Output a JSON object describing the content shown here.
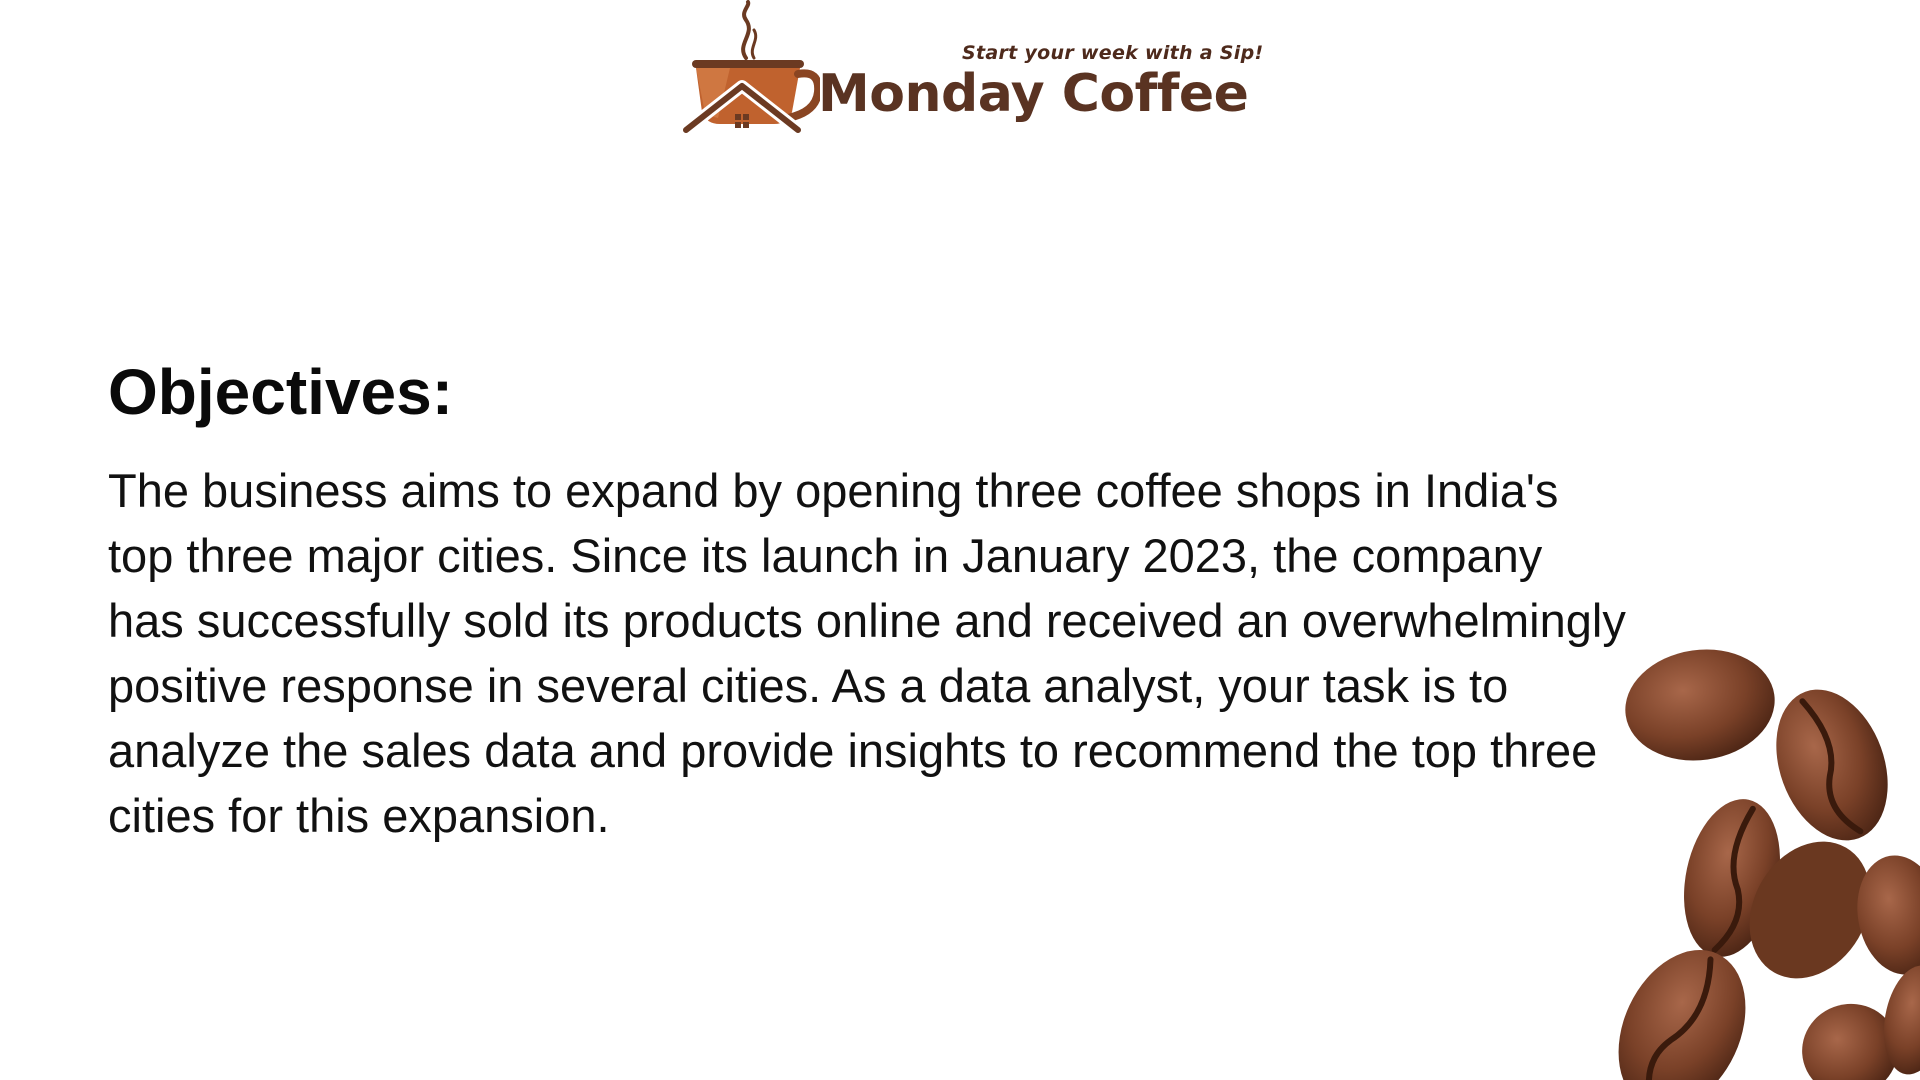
{
  "logo": {
    "tagline": "Start your week with a Sip!",
    "brand_name": "Monday Coffee"
  },
  "colors": {
    "brand_brown": "#5a3322",
    "cup_orange": "#c0622e",
    "bean_brown": "#6b3a22"
  },
  "section": {
    "title": "Objectives:",
    "body": "The business aims to expand by opening three coffee shops in India's top three major cities. Since its launch in January 2023, the company has successfully sold its products online and received an overwhelmingly positive response in several cities. As a data analyst, your task is to analyze the sales data and provide insights to recommend the top three cities for this expansion."
  },
  "decorations": {
    "logo_icon": "coffee-cup-house-icon",
    "beans_image": "coffee-beans-image"
  }
}
